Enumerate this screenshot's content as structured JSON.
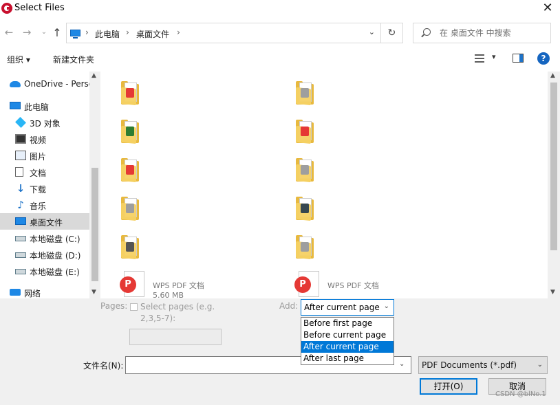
{
  "window": {
    "title": "Select Files"
  },
  "address": {
    "breadcrumbs": [
      "此电脑",
      "桌面文件"
    ],
    "search_placeholder": "在 桌面文件 中搜索"
  },
  "toolbar": {
    "organize_label": "组织 ▾",
    "new_folder_label": "新建文件夹",
    "help_label": "?"
  },
  "nav_pane": {
    "items": [
      {
        "label": "OneDrive - Perso",
        "icon": "onedrive-icon"
      },
      {
        "label": "此电脑",
        "icon": "this-pc-icon"
      },
      {
        "label": "3D 对象",
        "icon": "3d-objects-icon"
      },
      {
        "label": "视频",
        "icon": "video-icon"
      },
      {
        "label": "图片",
        "icon": "pictures-icon"
      },
      {
        "label": "文档",
        "icon": "documents-icon"
      },
      {
        "label": "下载",
        "icon": "downloads-icon"
      },
      {
        "label": "音乐",
        "icon": "music-icon"
      },
      {
        "label": "桌面文件",
        "icon": "desktop-icon",
        "selected": true
      },
      {
        "label": "本地磁盘 (C:)",
        "icon": "drive-icon"
      },
      {
        "label": "本地磁盘 (D:)",
        "icon": "drive-icon"
      },
      {
        "label": "本地磁盘 (E:)",
        "icon": "drive-icon"
      },
      {
        "label": "网络",
        "icon": "network-icon"
      }
    ]
  },
  "files": {
    "items": [
      {
        "badge": "pdf"
      },
      {
        "badge": "doc"
      },
      {
        "badge": "xls"
      },
      {
        "badge": "pdf"
      },
      {
        "badge": "pdf"
      },
      {
        "badge": "doc"
      },
      {
        "badge": "doc"
      },
      {
        "badge": "photo"
      },
      {
        "badge": "ink"
      },
      {
        "badge": "doc"
      }
    ],
    "pdf_files": [
      {
        "caption_line1": "WPS PDF 文档",
        "caption_line2": "5.60 MB"
      },
      {
        "caption_line1": "WPS PDF 文档",
        "caption_line2": ""
      }
    ]
  },
  "options": {
    "pages_label": "Pages:",
    "pages_checkbox_text": "Select pages (e.g. 2,3,5-7):",
    "pages_input_value": "",
    "add_label": "Add:",
    "add_selected": "After current page",
    "add_options": [
      "Before first page",
      "Before current page",
      "After current page",
      "After last page"
    ]
  },
  "footer": {
    "filename_label": "文件名(N):",
    "filename_value": "",
    "filetype_value": "PDF Documents (*.pdf)",
    "open_label": "打开(O)",
    "cancel_label": "取消",
    "watermark": "CSDN @blNo.1"
  }
}
